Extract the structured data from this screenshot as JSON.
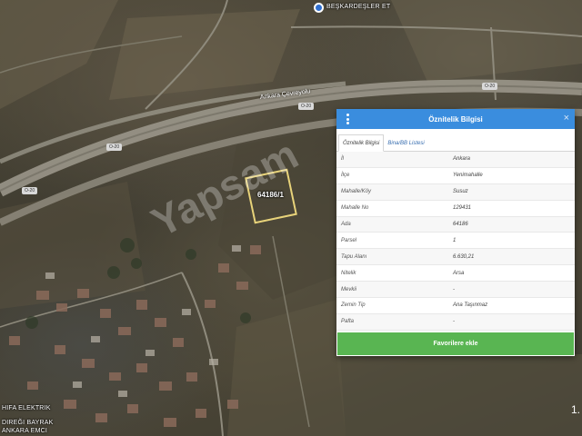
{
  "map": {
    "place_top": "BEŞKARDEŞLER ET",
    "road_name": "Ankara Çevreyolu",
    "road_shields": [
      "O-20",
      "O-20",
      "O-20",
      "O-20"
    ],
    "parcel_label": "64186/1",
    "watermark": "Yapsam",
    "place_bottom_1": "HIFA ELEKTRIK",
    "place_bottom_2": "DIREĞI BAYRAK",
    "place_bottom_3": "ANKARA EMCI",
    "corner_text": "1."
  },
  "panel": {
    "title": "Öznitelik Bilgisi",
    "close_glyph": "×",
    "tabs": [
      {
        "label": "Öznitelik Bilgisi",
        "active": true
      },
      {
        "label": "Bina/BB Listesi",
        "active": false
      }
    ],
    "rows": [
      {
        "key": "İl",
        "value": "Ankara"
      },
      {
        "key": "İlçe",
        "value": "Yenimahalle"
      },
      {
        "key": "Mahalle/Köy",
        "value": "Susuz"
      },
      {
        "key": "Mahalle No",
        "value": "129431"
      },
      {
        "key": "Ada",
        "value": "64186"
      },
      {
        "key": "Parsel",
        "value": "1"
      },
      {
        "key": "Tapu Alanı",
        "value": "6.630,21"
      },
      {
        "key": "Nitelik",
        "value": "Arsa"
      },
      {
        "key": "Mevkii",
        "value": "-"
      },
      {
        "key": "Zemin Tip",
        "value": "Ana Taşınmaz"
      },
      {
        "key": "Pafta",
        "value": "-"
      }
    ],
    "button_label": "Favorilere ekle"
  },
  "colors": {
    "header": "#3a8dde",
    "button": "#59b552",
    "parcel_outline": "#e8d37a"
  }
}
